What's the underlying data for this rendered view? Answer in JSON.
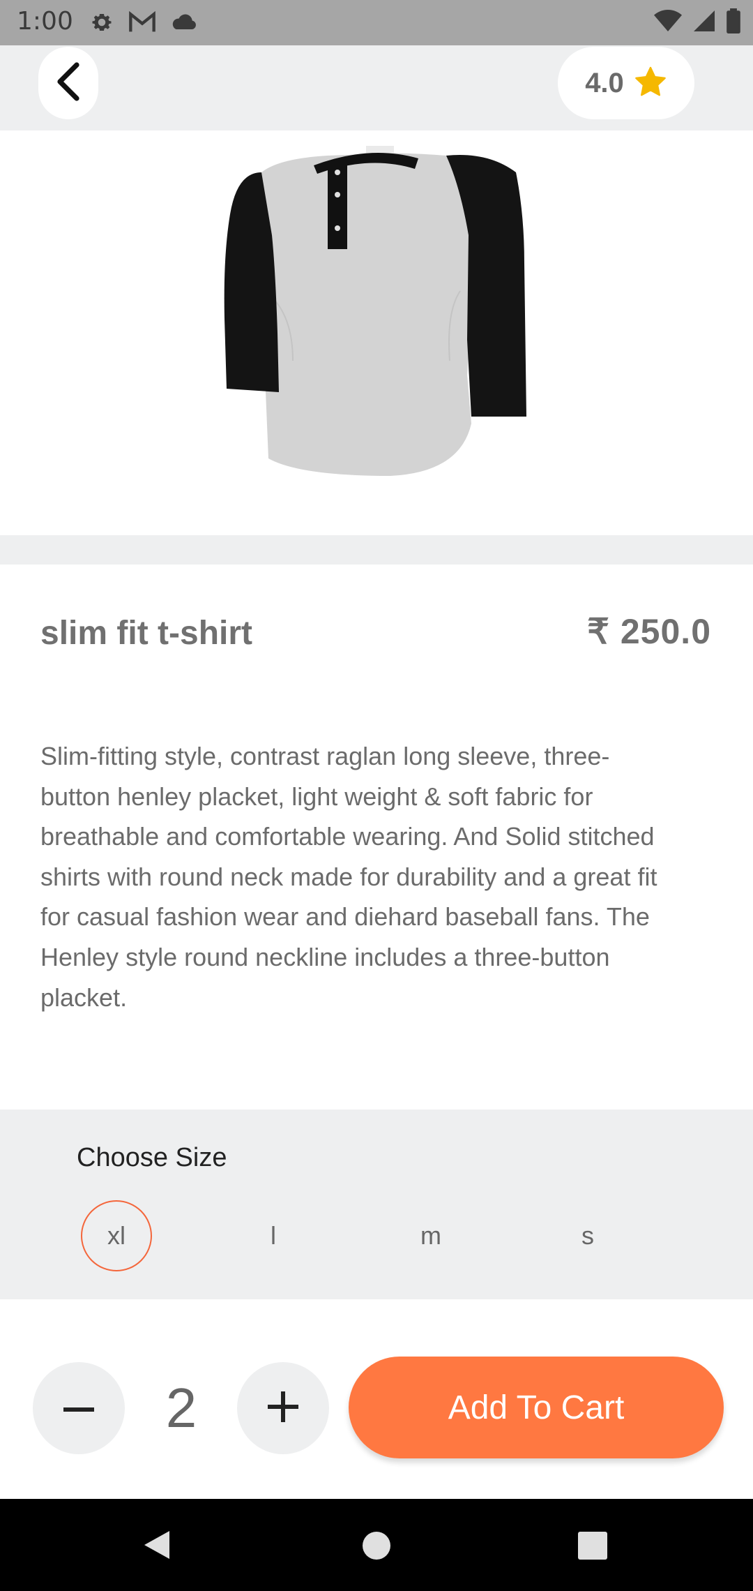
{
  "status_bar": {
    "time": "1:00",
    "left_icons": [
      "gear-icon",
      "gmail-icon",
      "cloud-icon"
    ],
    "right_icons": [
      "wifi-icon",
      "signal-icon",
      "battery-icon"
    ]
  },
  "header": {
    "back_icon": "chevron-left-icon",
    "rating": "4.0",
    "rating_icon": "star-icon",
    "star_color": "#f5b800"
  },
  "product": {
    "image_alt": "raglan henley t-shirt",
    "title": "slim fit t-shirt",
    "price": "₹ 250.0",
    "description": "Slim-fitting style, contrast raglan long sleeve, three-button henley placket, light weight & soft fabric for breathable and comfortable wearing. And Solid stitched shirts with round neck made for durability and a great fit for casual fashion wear and diehard baseball fans. The Henley style round neckline includes a three-button placket."
  },
  "sizes": {
    "label": "Choose Size",
    "options": [
      "xl",
      "l",
      "m",
      "s"
    ],
    "selected": "xl"
  },
  "cart": {
    "quantity": "2",
    "decrement_icon": "minus-icon",
    "increment_icon": "plus-icon",
    "add_label": "Add To Cart",
    "accent_color": "#ff7841"
  },
  "nav_bar": {
    "icons": [
      "back-triangle-icon",
      "home-circle-icon",
      "recents-square-icon"
    ]
  }
}
